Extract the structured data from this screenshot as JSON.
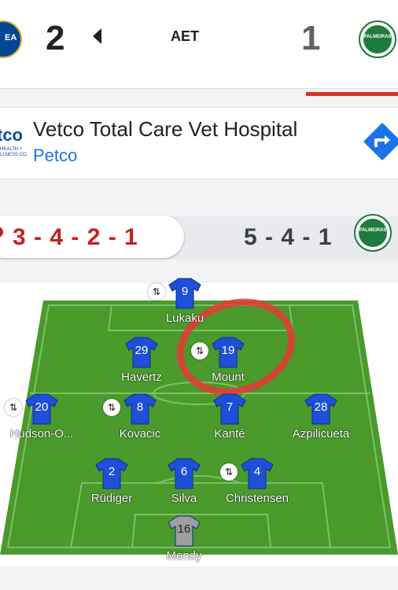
{
  "match": {
    "home_score": "2",
    "away_score": "1",
    "status": "AET",
    "home_crest_text": "EA",
    "away_crest_text": "PALMEIRAS"
  },
  "ad": {
    "logo_text": "tco",
    "logo_small": "HEALTH + LLNESS CO.",
    "title": "Vetco Total Care Vet Hospital",
    "subtitle": "Petco"
  },
  "formations": {
    "home": "3 - 4 - 2 - 1",
    "away": "5 - 4 - 1"
  },
  "colors": {
    "home_kit": "#1e4fd8",
    "keeper_kit": "#9e9e9e",
    "pitch": "#4a9a2c",
    "accent_red": "#d93025"
  },
  "players": [
    {
      "number": "9",
      "name": "Lukaku",
      "sub": true,
      "keeper": false
    },
    {
      "number": "29",
      "name": "Havertz",
      "sub": false,
      "keeper": false
    },
    {
      "number": "19",
      "name": "Mount",
      "sub": true,
      "keeper": false
    },
    {
      "number": "20",
      "name": "Hudson-O...",
      "sub": true,
      "keeper": false
    },
    {
      "number": "8",
      "name": "Kovacic",
      "sub": true,
      "keeper": false
    },
    {
      "number": "7",
      "name": "Kanté",
      "sub": false,
      "keeper": false
    },
    {
      "number": "28",
      "name": "Azpilicueta",
      "sub": false,
      "keeper": false
    },
    {
      "number": "2",
      "name": "Rüdiger",
      "sub": false,
      "keeper": false
    },
    {
      "number": "6",
      "name": "Silva",
      "sub": false,
      "keeper": false
    },
    {
      "number": "4",
      "name": "Christensen",
      "sub": true,
      "keeper": false
    },
    {
      "number": "16",
      "name": "Mendy",
      "sub": false,
      "keeper": true
    }
  ],
  "icons": {
    "sub": "substitution-icon",
    "directions": "directions-icon",
    "back": "chevron-left-icon"
  }
}
